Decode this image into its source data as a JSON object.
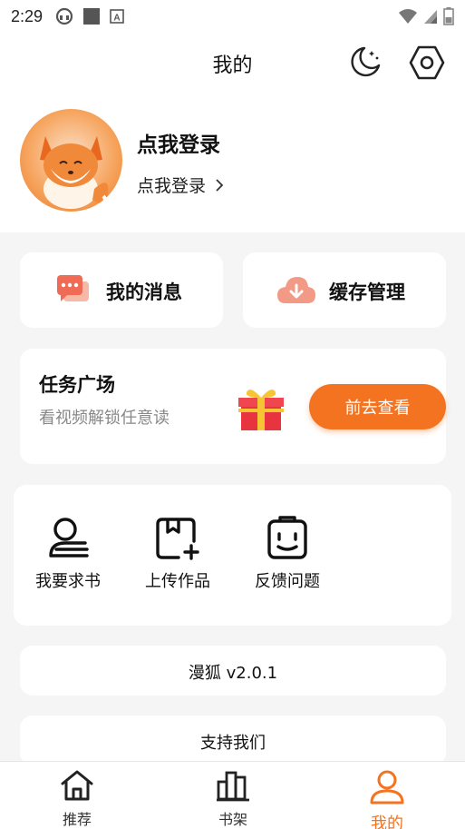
{
  "status_bar": {
    "time": "2:29"
  },
  "header": {
    "title": "我的"
  },
  "profile": {
    "name": "点我登录",
    "sub_label": "点我登录"
  },
  "quick_actions": [
    {
      "label": "我的消息",
      "icon": "message-icon"
    },
    {
      "label": "缓存管理",
      "icon": "cloud-download-icon"
    }
  ],
  "task": {
    "title": "任务广场",
    "subtitle": "看视频解锁任意读",
    "button_label": "前去查看"
  },
  "tools": [
    {
      "label": "我要求书",
      "icon": "request-book-icon"
    },
    {
      "label": "上传作品",
      "icon": "upload-work-icon"
    },
    {
      "label": "反馈问题",
      "icon": "feedback-icon"
    }
  ],
  "rows": [
    {
      "label": "漫狐 v2.0.1"
    },
    {
      "label": "支持我们"
    }
  ],
  "tabs": [
    {
      "label": "推荐",
      "icon": "home-icon"
    },
    {
      "label": "书架",
      "icon": "bookshelf-icon"
    },
    {
      "label": "我的",
      "icon": "user-icon"
    }
  ],
  "colors": {
    "accent": "#f47321",
    "background": "#f5f5f5",
    "card": "#ffffff"
  }
}
